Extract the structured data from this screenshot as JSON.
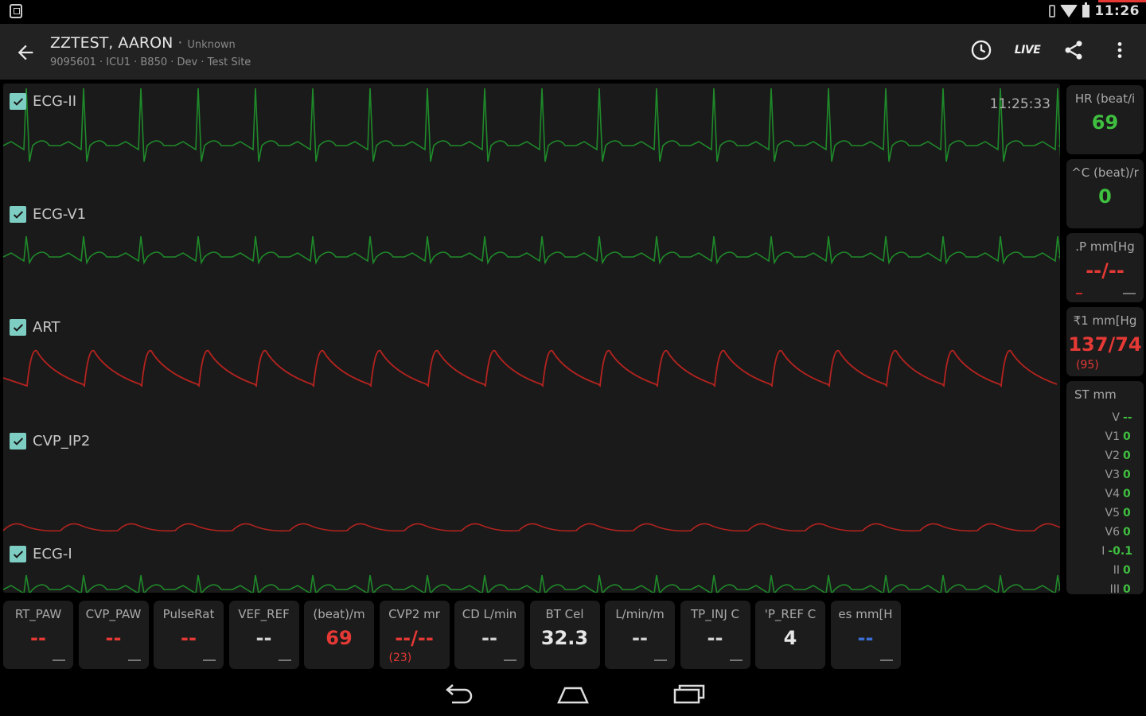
{
  "status": {
    "time": "11:26"
  },
  "header": {
    "patient_name": "ZZTEST, AARON",
    "separator": " · ",
    "sex": "Unknown",
    "subtitle": "9095601 · ICU1 · B850 · Dev · Test Site",
    "live_label": "LIVE"
  },
  "waveform_panel": {
    "timestamp": "11:25:33",
    "channels": [
      {
        "label": "ECG-II",
        "color": "#1f8a2a"
      },
      {
        "label": "ECG-V1",
        "color": "#1f8a2a"
      },
      {
        "label": "ART",
        "color": "#b3231f"
      },
      {
        "label": "CVP_IP2",
        "color": "#b3231f"
      },
      {
        "label": "ECG-I",
        "color": "#1f8a2a"
      }
    ]
  },
  "side_tiles": [
    {
      "label": "HR (beat/i",
      "value": "69",
      "color": "#3fbf3f"
    },
    {
      "label": "^C (beat)/r",
      "value": "0",
      "color": "#3fbf3f"
    },
    {
      "label": ".P mm[Hg",
      "value": "--/--",
      "color": "#e53935"
    },
    {
      "label": "₹1 mm[Hg",
      "value": "137/74",
      "sub": "(95)",
      "color": "#e53935"
    }
  ],
  "st_tile": {
    "label": "ST mm",
    "rows": [
      {
        "k": "V",
        "v": "--"
      },
      {
        "k": "V1",
        "v": "0"
      },
      {
        "k": "V2",
        "v": "0"
      },
      {
        "k": "V3",
        "v": "0"
      },
      {
        "k": "V4",
        "v": "0"
      },
      {
        "k": "V5",
        "v": "0"
      },
      {
        "k": "V6",
        "v": "0"
      },
      {
        "k": "I",
        "v": "-0.1"
      },
      {
        "k": "II",
        "v": "0"
      },
      {
        "k": "III",
        "v": "0"
      }
    ],
    "color": "#3fbf3f"
  },
  "bottom_tiles": [
    {
      "label": "RT_PAW",
      "value": "--",
      "color": "#e53935"
    },
    {
      "label": "CVP_PAW",
      "value": "--",
      "color": "#e53935"
    },
    {
      "label": "PulseRat",
      "value": "--",
      "color": "#e53935"
    },
    {
      "label": "VEF_REF",
      "value": "--",
      "color": "#d0d0d0"
    },
    {
      "label": "(beat)/m",
      "value": "69",
      "color": "#e53935"
    },
    {
      "label": "CVP2 mr",
      "value": "--/--",
      "sub": "(23)",
      "color": "#e53935"
    },
    {
      "label": "CD L/min",
      "value": "--",
      "color": "#d0d0d0"
    },
    {
      "label": "BT Cel",
      "value": "32.3",
      "color": "#e6e6e6"
    },
    {
      "label": "L/min/m",
      "value": "--",
      "color": "#d0d0d0"
    },
    {
      "label": "TP_INJ C",
      "value": "--",
      "color": "#d0d0d0"
    },
    {
      "label": "'P_REF C",
      "value": "4",
      "color": "#e6e6e6"
    },
    {
      "label": "es mm[H",
      "value": "--",
      "color": "#3b6fd6"
    }
  ]
}
